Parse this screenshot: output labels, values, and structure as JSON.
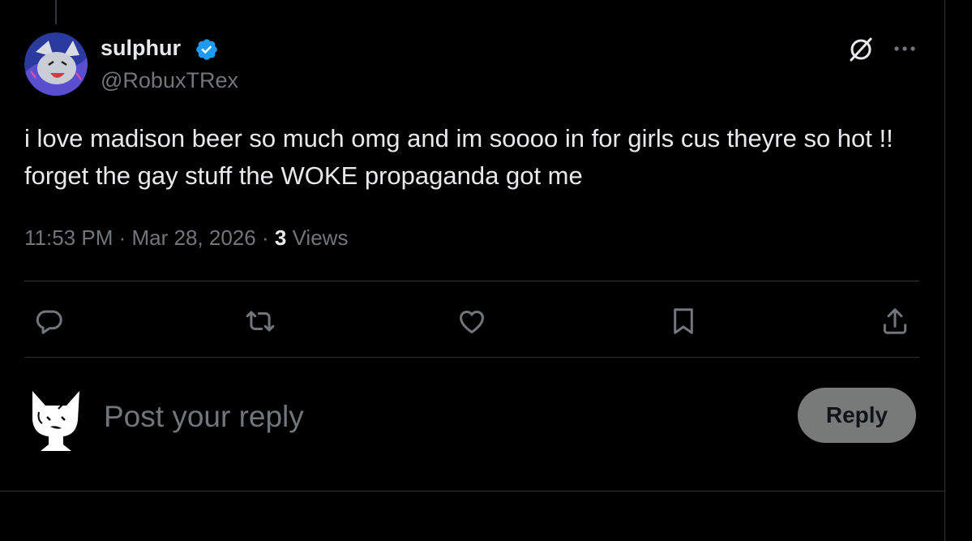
{
  "post": {
    "author_name": "sulphur",
    "handle": "@RobuxTRex",
    "verified": true,
    "text": "i love madison beer so much omg and im soooo in for girls cus theyre so hot !! forget the gay stuff the WOKE propaganda got me",
    "time": "11:53 PM",
    "separator": "·",
    "date": "Mar 28, 2026",
    "views_count": "3",
    "views_label": "Views"
  },
  "actions": {
    "icons": [
      "reply-icon",
      "repost-icon",
      "like-icon",
      "bookmark-icon",
      "share-icon"
    ]
  },
  "reply_box": {
    "placeholder": "Post your reply",
    "button_label": "Reply"
  },
  "colors": {
    "background": "#000000",
    "text_primary": "#e7e9ea",
    "text_secondary": "#71767b",
    "verified": "#1d9bf0",
    "reply_button_bg": "#787a7a",
    "divider": "#2f3336"
  }
}
